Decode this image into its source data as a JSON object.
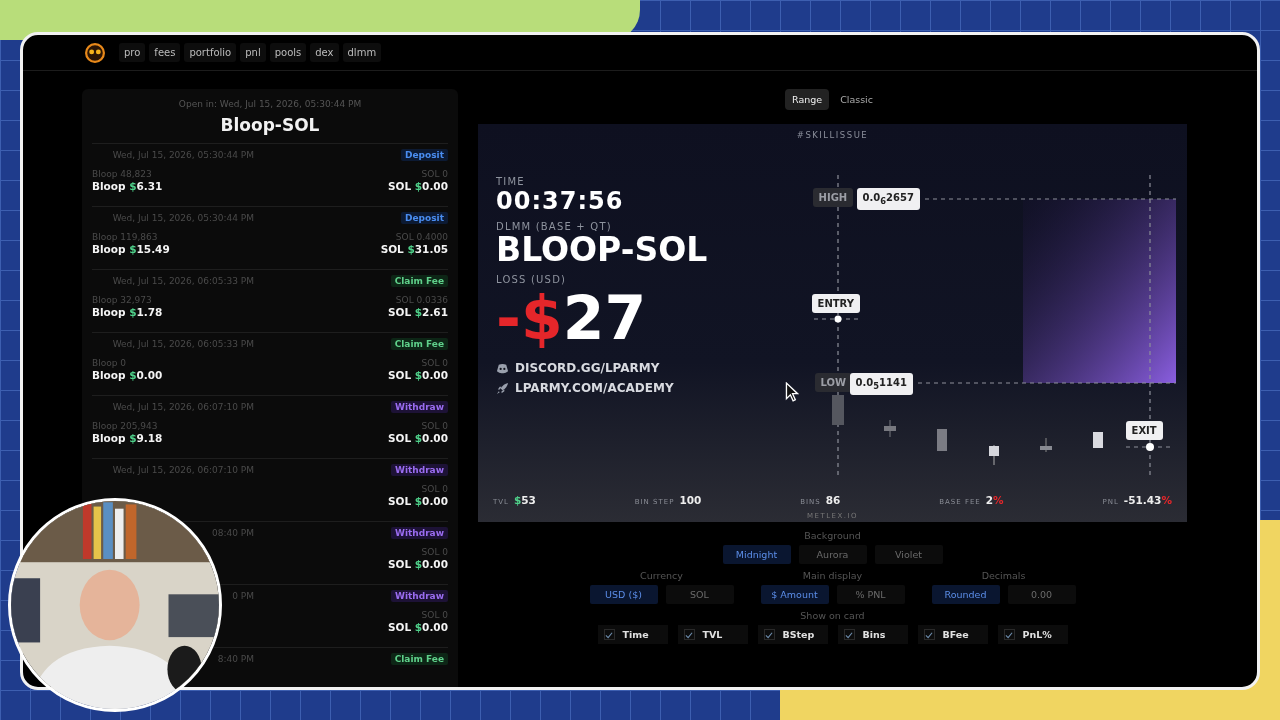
{
  "nav": {
    "items": [
      "pro",
      "fees",
      "portfolio",
      "pnl",
      "pools",
      "dex",
      "dlmm"
    ]
  },
  "history": {
    "opened": "Open in: Wed, Jul 15, 2026, 05:30:44 PM",
    "title": "Bloop-SOL",
    "entries": [
      {
        "date": "Wed, Jul 15, 2026, 05:30:44 PM",
        "kind": "deposit",
        "badge": "Deposit",
        "base": {
          "amount": "Bloop 48,823",
          "token": "Bloop",
          "sign": "$",
          "value": "6.31"
        },
        "quote": {
          "amount": "SOL 0",
          "token": "SOL",
          "sign": "$",
          "value": "0.00"
        }
      },
      {
        "date": "Wed, Jul 15, 2026, 05:30:44 PM",
        "kind": "deposit",
        "badge": "Deposit",
        "base": {
          "amount": "Bloop 119,863",
          "token": "Bloop",
          "sign": "$",
          "value": "15.49"
        },
        "quote": {
          "amount": "SOL 0.4000",
          "token": "SOL",
          "sign": "$",
          "value": "31.05"
        }
      },
      {
        "date": "Wed, Jul 15, 2026, 06:05:33 PM",
        "kind": "claim",
        "badge": "Claim Fee",
        "base": {
          "amount": "Bloop 32,973",
          "token": "Bloop",
          "sign": "$",
          "value": "1.78"
        },
        "quote": {
          "amount": "SOL 0.0336",
          "token": "SOL",
          "sign": "$",
          "value": "2.61"
        }
      },
      {
        "date": "Wed, Jul 15, 2026, 06:05:33 PM",
        "kind": "claim",
        "badge": "Claim Fee",
        "base": {
          "amount": "Bloop 0",
          "token": "Bloop",
          "sign": "$",
          "value": "0.00"
        },
        "quote": {
          "amount": "SOL 0",
          "token": "SOL",
          "sign": "$",
          "value": "0.00"
        }
      },
      {
        "date": "Wed, Jul 15, 2026, 06:07:10 PM",
        "kind": "withdraw",
        "badge": "Withdraw",
        "base": {
          "amount": "Bloop 205,943",
          "token": "Bloop",
          "sign": "$",
          "value": "9.18"
        },
        "quote": {
          "amount": "SOL 0",
          "token": "SOL",
          "sign": "$",
          "value": "0.00"
        }
      },
      {
        "date": "Wed, Jul 15, 2026, 06:07:10 PM",
        "kind": "withdraw",
        "badge": "Withdraw",
        "quote": {
          "amount": "SOL 0",
          "token": "SOL",
          "sign": "$",
          "value": "0.00"
        }
      },
      {
        "date": "08:40 PM",
        "kind": "withdraw",
        "badge": "Withdraw",
        "quote": {
          "amount": "SOL 0",
          "token": "SOL",
          "sign": "$",
          "value": "0.00"
        }
      },
      {
        "date": "0 PM",
        "kind": "withdraw",
        "badge": "Withdraw",
        "quote": {
          "amount": "SOL 0",
          "token": "SOL",
          "sign": "$",
          "value": "0.00"
        }
      },
      {
        "date": "8:40 PM",
        "kind": "claim",
        "badge": "Claim Fee"
      }
    ]
  },
  "view_toggle": [
    {
      "label": "Range",
      "selected": true
    },
    {
      "label": "Classic",
      "selected": false
    }
  ],
  "card": {
    "tag": "#SKILLISSUE",
    "time_label": "TIME",
    "time": "00:37:56",
    "pair_label": "DLMM (BASE + QT)",
    "pair": "BLOOP-SOL",
    "result_label": "LOSS (USD)",
    "result_sign": "-$",
    "result_value": "27",
    "links": [
      {
        "kind": "discord",
        "text": "DISCORD.GG/LPARMY"
      },
      {
        "kind": "rocket",
        "text": "LPARMY.COM/ACADEMY"
      }
    ],
    "range": {
      "high_label": "HIGH",
      "high": "0.0$_{6}$2657",
      "entry_label": "ENTRY",
      "low_label": "LOW",
      "low": "0.0$_{5}$1141",
      "exit_label": "EXIT"
    },
    "stats": [
      {
        "label": "TVL",
        "prefix": "$",
        "value": "53"
      },
      {
        "label": "BIN STEP",
        "value": "100"
      },
      {
        "label": "BINS",
        "value": "86"
      },
      {
        "label": "BASE FEE",
        "value": "2",
        "suffix": "%"
      },
      {
        "label": "PNL",
        "value": "-51.43",
        "suffix": "%"
      }
    ],
    "footer": "METLEX.IO"
  },
  "settings": {
    "background": {
      "label": "Background",
      "options": [
        {
          "label": "Midnight",
          "selected": true
        },
        {
          "label": "Aurora",
          "selected": false
        },
        {
          "label": "Violet",
          "selected": false
        }
      ]
    },
    "groups": [
      {
        "label": "Currency",
        "options": [
          {
            "label": "USD ($)",
            "selected": true
          },
          {
            "label": "SOL",
            "selected": false
          }
        ]
      },
      {
        "label": "Main display",
        "options": [
          {
            "label": "$ Amount",
            "selected": true
          },
          {
            "label": "% PNL",
            "selected": false
          }
        ]
      },
      {
        "label": "Decimals",
        "options": [
          {
            "label": "Rounded",
            "selected": true
          },
          {
            "label": "0.00",
            "selected": false
          }
        ]
      }
    ],
    "show_on_card": {
      "label": "Show on card",
      "items": [
        {
          "label": "Time",
          "checked": true
        },
        {
          "label": "TVL",
          "checked": true
        },
        {
          "label": "BStep",
          "checked": true
        },
        {
          "label": "Bins",
          "checked": true
        },
        {
          "label": "BFee",
          "checked": true
        },
        {
          "label": "PnL%",
          "checked": true
        }
      ]
    }
  }
}
